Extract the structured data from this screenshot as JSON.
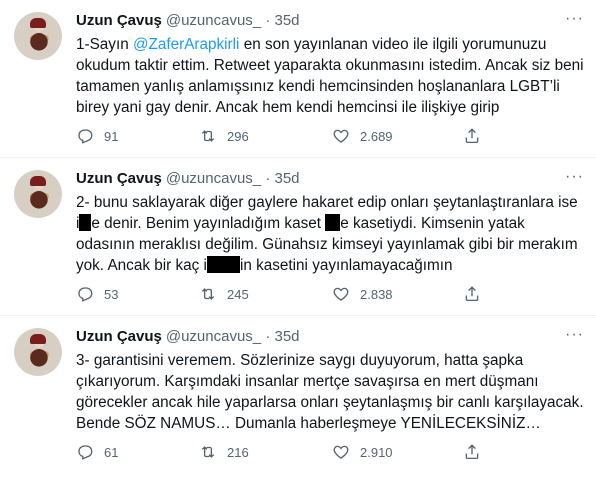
{
  "tweets": [
    {
      "name": "Uzun Çavuş",
      "handle": "@uzuncavus_",
      "dot": "·",
      "time": "35d",
      "more": "···",
      "text": {
        "p1": "1-Sayın ",
        "mention": "@ZaferArapkirli",
        "p2": " en son yayınlanan video ile ilgili yorumunuzu okudum taktir ettim. Retweet yaparakta okunmasını istedim. Ancak siz beni tamamen yanlış anlamışsınız kendi hemcinsinden hoşlananlara LGBT’li birey yani gay denir. Ancak hem kendi hemcinsi ile ilişkiye girip"
      },
      "replies": "91",
      "retweets": "296",
      "likes": "2.689"
    },
    {
      "name": "Uzun Çavuş",
      "handle": "@uzuncavus_",
      "dot": "·",
      "time": "35d",
      "more": "···",
      "text": {
        "p1": "2- bunu saklayarak diğer gaylere hakaret edip onları şeytanlaştıranlara ise i",
        "p2": "e denir. Benim yayınladığım kaset ",
        "p3": "e kasetiydi. Kimsenin yatak odasının meraklısı değilim. Günahsız kimseyi yayınlamak gibi bir merakım yok. Ancak bir kaç i",
        "p4": "in kasetini yayınlamayacağımın"
      },
      "replies": "53",
      "retweets": "245",
      "likes": "2.838"
    },
    {
      "name": "Uzun Çavuş",
      "handle": "@uzuncavus_",
      "dot": "·",
      "time": "35d",
      "more": "···",
      "text": {
        "p1": "3- garantisini veremem. Sözlerinize saygı duyuyorum, hatta şapka çıkarıyorum. Karşımdaki insanlar mertçe savaşırsa en mert düşmanı görecekler ancak hile yaparlarsa onları şeytanlaşmış bir canlı karşılayacak. Bende SÖZ NAMUS… Dumanla haberleşmeye YENİLECEKSİNİZ…"
      },
      "replies": "61",
      "retweets": "216",
      "likes": "2.910"
    }
  ],
  "icons": {
    "reply": "reply-icon",
    "retweet": "retweet-icon",
    "like": "like-icon",
    "share": "share-icon",
    "more": "more-icon"
  },
  "colors": {
    "link": "#1d9bf0",
    "secondary": "#536471",
    "text": "#0f1419"
  }
}
